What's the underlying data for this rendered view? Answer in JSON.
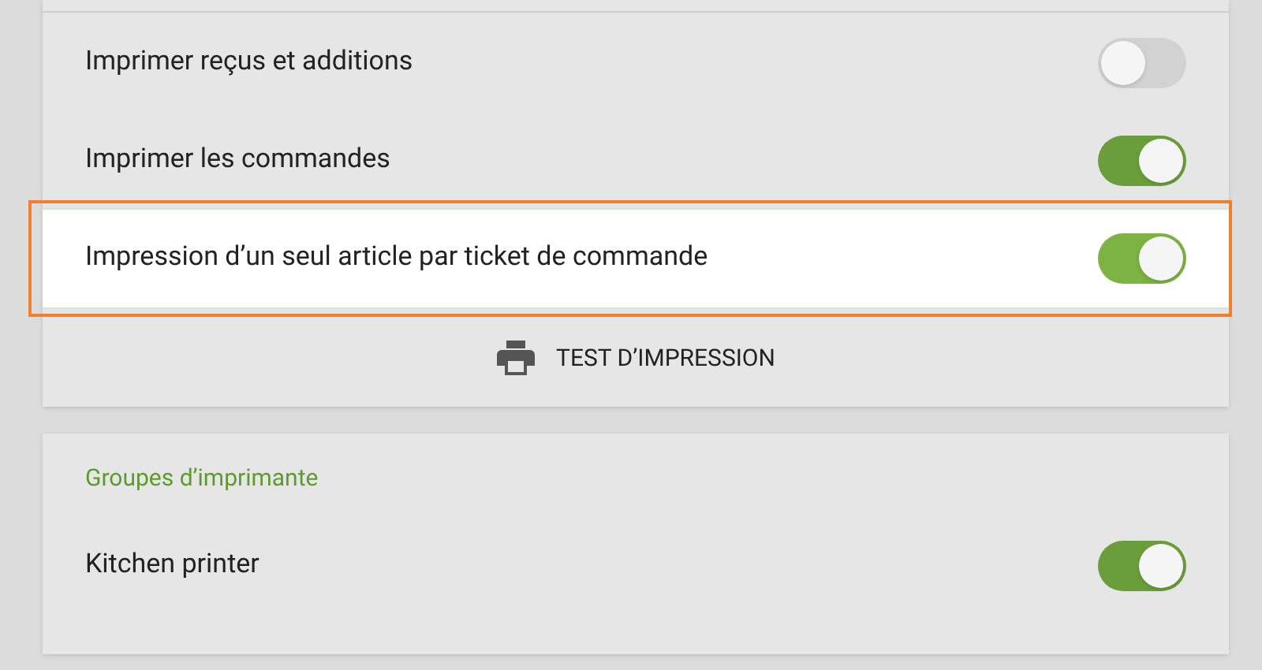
{
  "printing_card": {
    "settings": [
      {
        "label": "Imprimer reçus et additions",
        "on": false,
        "highlighted": false
      },
      {
        "label": "Imprimer les commandes",
        "on": true,
        "highlighted": false
      },
      {
        "label": "Impression d’un seul article par ticket de commande",
        "on": true,
        "highlighted": true
      }
    ],
    "test_button": "TEST D’IMPRESSION"
  },
  "printer_groups_card": {
    "title": "Groupes d’imprimante",
    "settings": [
      {
        "label": "Kitchen printer",
        "on": true,
        "highlighted": false
      }
    ]
  }
}
